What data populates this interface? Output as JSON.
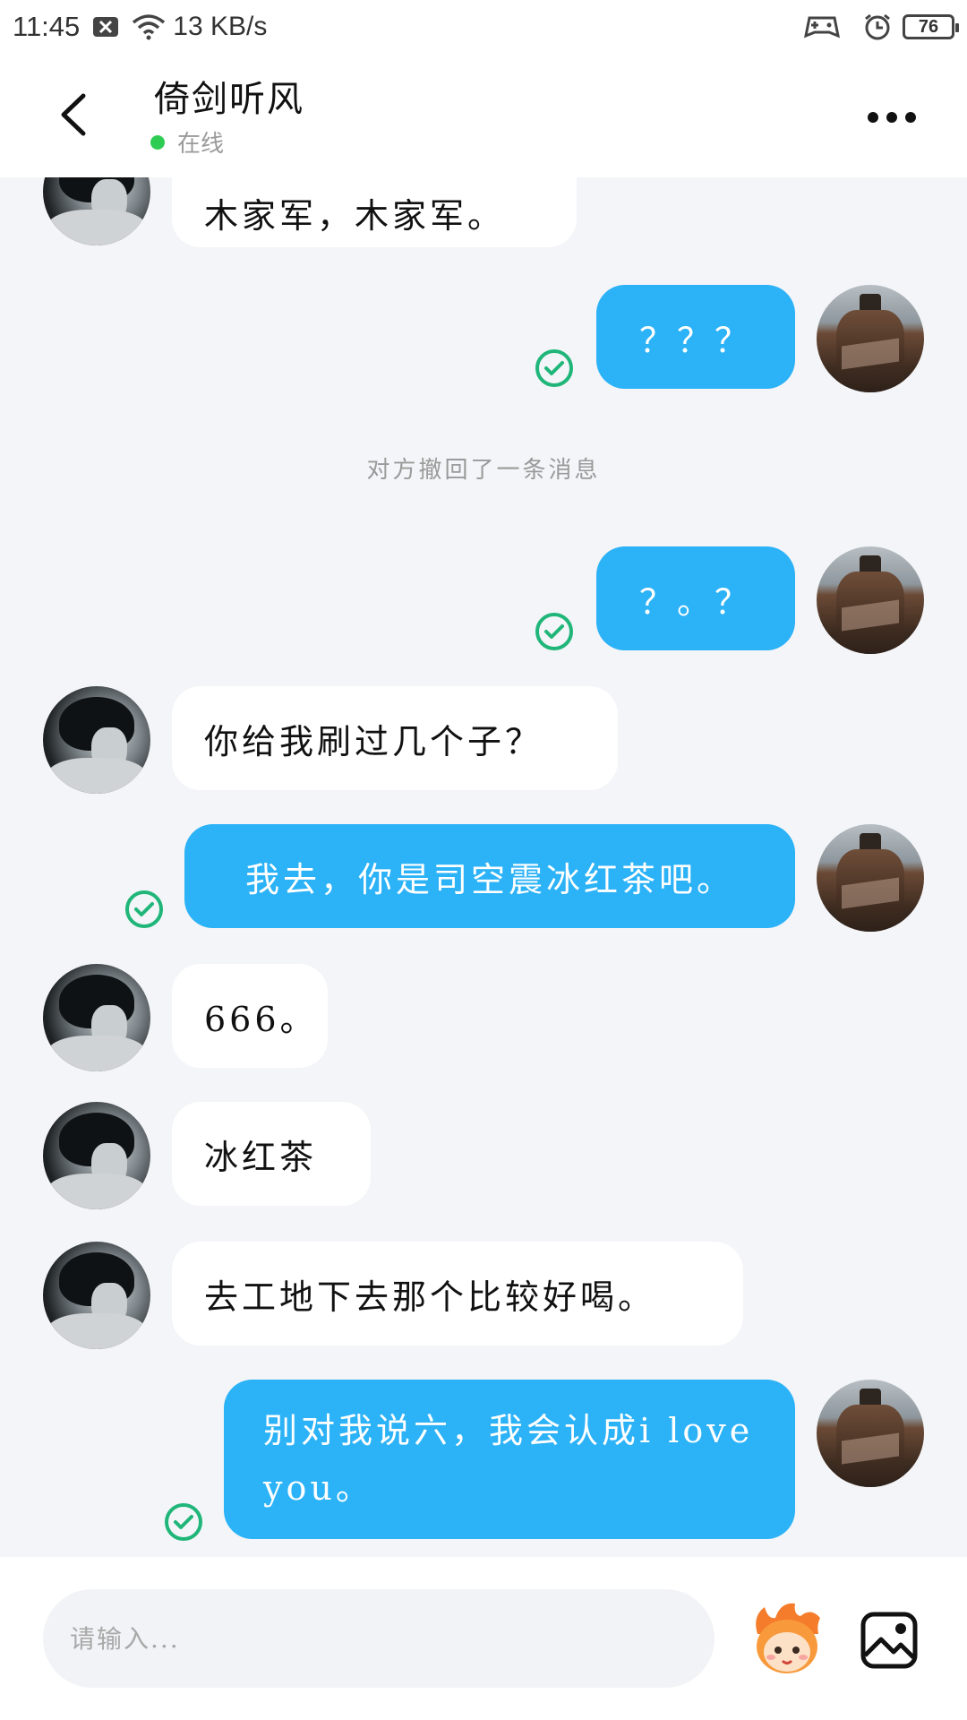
{
  "status_bar": {
    "time": "11:45",
    "net_speed": "13 KB/s",
    "battery": "76",
    "icons": [
      "close-box-icon",
      "wifi-icon",
      "gamepad-icon",
      "alarm-icon",
      "battery-icon"
    ]
  },
  "header": {
    "title": "倚剑听风",
    "status": "在线",
    "status_color": "#2fcc53"
  },
  "messages": [
    {
      "side": "left",
      "text": "木家军，木家军。"
    },
    {
      "side": "right",
      "text": "？？？"
    },
    {
      "side": "system",
      "text": "对方撤回了一条消息"
    },
    {
      "side": "right",
      "text": "？。？"
    },
    {
      "side": "left",
      "text": "你给我刷过几个子？"
    },
    {
      "side": "right",
      "text": "我去，你是司空震冰红茶吧。"
    },
    {
      "side": "left",
      "text": "666。"
    },
    {
      "side": "left",
      "text": "冰红茶"
    },
    {
      "side": "left",
      "text": "去工地下去那个比较好喝。"
    },
    {
      "side": "right",
      "line1": "别对我说六，我会认成i love",
      "line2": "you。"
    }
  ],
  "input": {
    "placeholder": "请输入..."
  },
  "colors": {
    "accent": "#2bb2f7",
    "check": "#20b67a",
    "background": "#f4f5f8"
  }
}
